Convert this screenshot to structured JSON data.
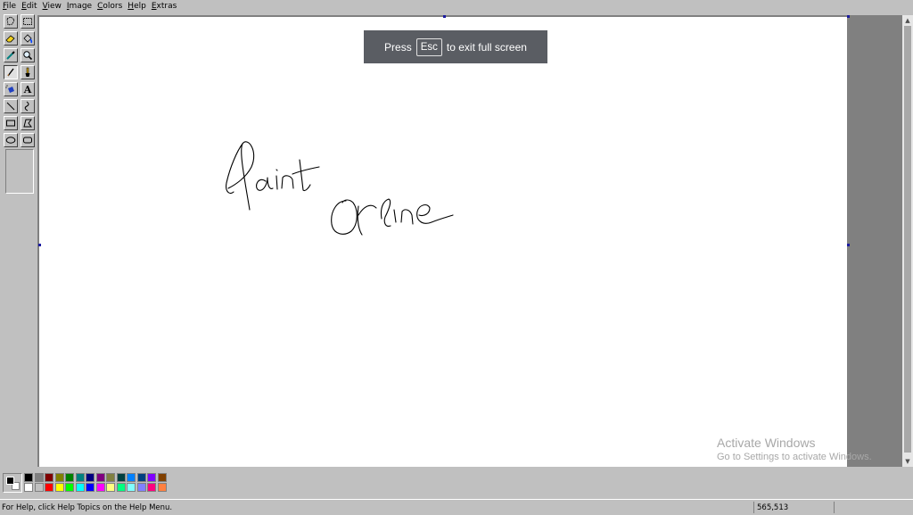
{
  "menu": {
    "items": [
      "File",
      "Edit",
      "View",
      "Image",
      "Colors",
      "Help",
      "Extras"
    ]
  },
  "toolbox": {
    "tools": [
      {
        "id": "free-select",
        "icon": "free-form-select-icon"
      },
      {
        "id": "select",
        "icon": "rect-select-icon"
      },
      {
        "id": "eraser",
        "icon": "eraser-icon"
      },
      {
        "id": "fill",
        "icon": "fill-bucket-icon"
      },
      {
        "id": "pick-color",
        "icon": "color-picker-icon"
      },
      {
        "id": "magnifier",
        "icon": "magnifier-icon"
      },
      {
        "id": "pencil",
        "icon": "pencil-icon",
        "active": true
      },
      {
        "id": "brush",
        "icon": "brush-icon"
      },
      {
        "id": "airbrush",
        "icon": "airbrush-icon"
      },
      {
        "id": "text",
        "icon": "text-icon",
        "glyph": "A"
      },
      {
        "id": "line",
        "icon": "line-icon"
      },
      {
        "id": "curve",
        "icon": "curve-icon"
      },
      {
        "id": "rectangle",
        "icon": "rectangle-icon"
      },
      {
        "id": "polygon",
        "icon": "polygon-icon"
      },
      {
        "id": "ellipse",
        "icon": "ellipse-icon"
      },
      {
        "id": "rounded-rectangle",
        "icon": "rounded-rectangle-icon"
      }
    ]
  },
  "fullscreen_toast": {
    "press": "Press",
    "key": "Esc",
    "rest": "to exit full screen"
  },
  "watermark": {
    "title": "Activate Windows",
    "subtitle": "Go to Settings to activate Windows."
  },
  "palette": {
    "foreground": "#000000",
    "background": "#ffffff",
    "top_row": [
      "#000000",
      "#808080",
      "#800000",
      "#808000",
      "#008000",
      "#008080",
      "#000080",
      "#800080",
      "#808040",
      "#004040",
      "#0080ff",
      "#004080",
      "#8000ff",
      "#804000"
    ],
    "bottom_row": [
      "#ffffff",
      "#c0c0c0",
      "#ff0000",
      "#ffff00",
      "#00ff00",
      "#00ffff",
      "#0000ff",
      "#ff00ff",
      "#ffff80",
      "#00ff80",
      "#80ffff",
      "#8080ff",
      "#ff0080",
      "#ff8040"
    ]
  },
  "status": {
    "help_text": "For Help, click Help Topics on the Help Menu.",
    "coords": "565,513"
  },
  "colors": {
    "chrome": "#c0c0c0",
    "workspace": "#808080",
    "canvas": "#ffffff",
    "stroke": "#000000"
  }
}
